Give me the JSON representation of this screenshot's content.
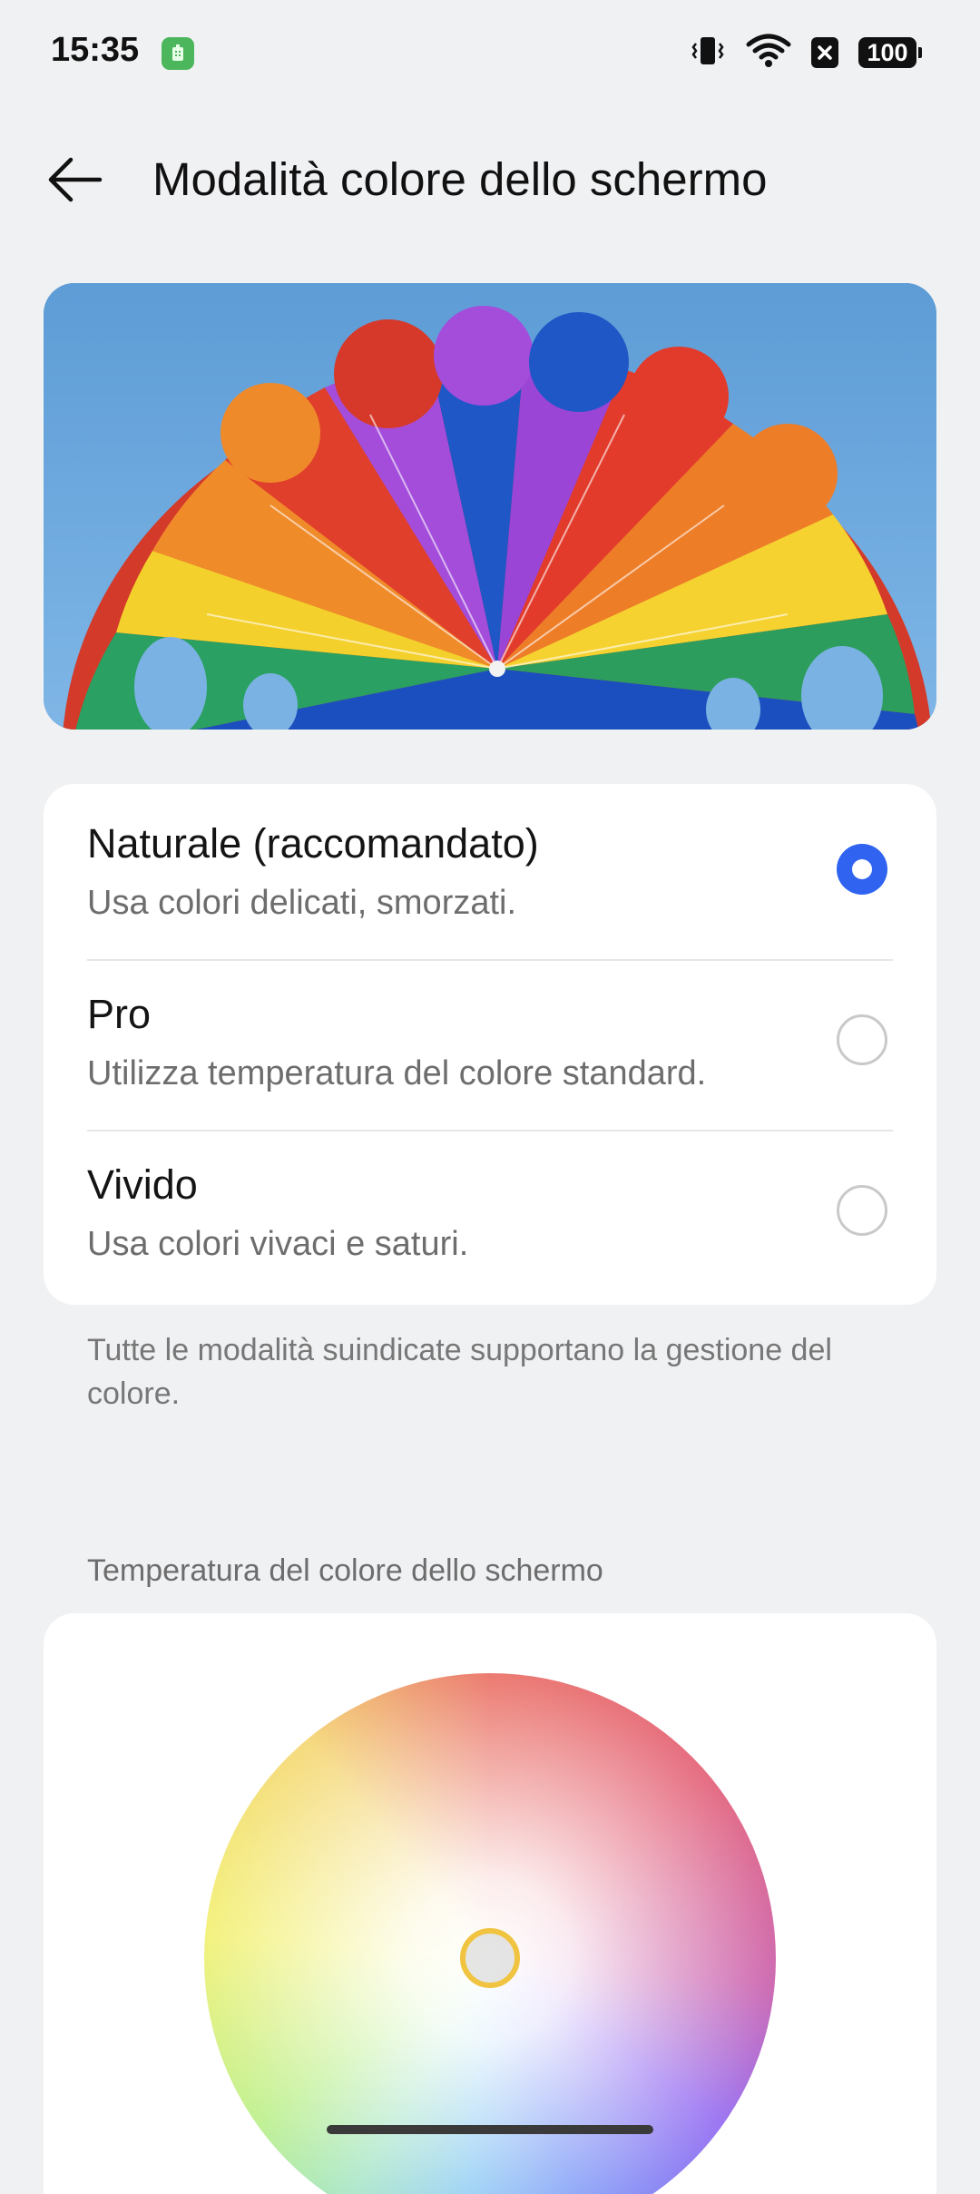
{
  "status_bar": {
    "time": "15:35",
    "battery": "100",
    "icons": [
      "app-notification-icon",
      "vibrate-icon",
      "wifi-icon",
      "no-sim-icon",
      "battery-icon"
    ]
  },
  "header": {
    "title": "Modalità colore dello schermo",
    "back_icon": "back-arrow-icon"
  },
  "preview_image": {
    "subject": "rainbow parasail against blue sky"
  },
  "color_modes": {
    "selected_index": 0,
    "options": [
      {
        "title": "Naturale (raccomandato)",
        "description": "Usa colori delicati, smorzati.",
        "checked": true
      },
      {
        "title": "Pro",
        "description": "Utilizza temperatura del colore standard.",
        "checked": false
      },
      {
        "title": "Vivido",
        "description": "Usa colori vivaci e saturi.",
        "checked": false
      }
    ]
  },
  "footnote": "Tutte le modalità suindicate supportano la gestione del colore.",
  "temperature": {
    "section_title": "Temperatura del colore dello schermo"
  },
  "colors": {
    "accent": "#2f63f0",
    "background": "#f0f1f3",
    "card": "#ffffff",
    "handle": "#f0c440"
  }
}
